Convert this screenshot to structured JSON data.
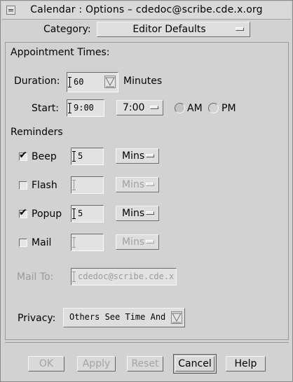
{
  "window": {
    "title": "Calendar : Options – cdedoc@scribe.cde.x.org"
  },
  "category": {
    "label": "Category:",
    "value": "Editor Defaults"
  },
  "appointment": {
    "heading": "Appointment Times:",
    "duration_label": "Duration:",
    "duration_value": "60",
    "duration_unit": "Minutes",
    "start_label": "Start:",
    "start_value": "9:00",
    "start_menu": "7:00",
    "am_label": "AM",
    "pm_label": "PM",
    "am_selected": true
  },
  "reminders": {
    "heading": "Reminders",
    "items": [
      {
        "label": "Beep",
        "checked": true,
        "value": "5",
        "unit": "Mins",
        "enabled": true
      },
      {
        "label": "Flash",
        "checked": false,
        "value": "",
        "unit": "Mins",
        "enabled": false
      },
      {
        "label": "Popup",
        "checked": true,
        "value": "5",
        "unit": "Mins",
        "enabled": true
      },
      {
        "label": "Mail",
        "checked": false,
        "value": "",
        "unit": "Mins",
        "enabled": false
      }
    ]
  },
  "mail_to": {
    "label": "Mail To:",
    "value": "cdedoc@scribe.cde.x."
  },
  "privacy": {
    "label": "Privacy:",
    "value": "Others See Time And"
  },
  "buttons": {
    "ok": "OK",
    "apply": "Apply",
    "reset": "Reset",
    "cancel": "Cancel",
    "help": "Help"
  },
  "icons": {
    "window_menu": "window-menu-icon",
    "combo": "combo-arrow-icon",
    "option": "option-menu-indicator-icon",
    "check": "checkmark-icon"
  },
  "colors": {
    "background": "#d2d2d2",
    "disabled_text": "#9a9a9a"
  }
}
